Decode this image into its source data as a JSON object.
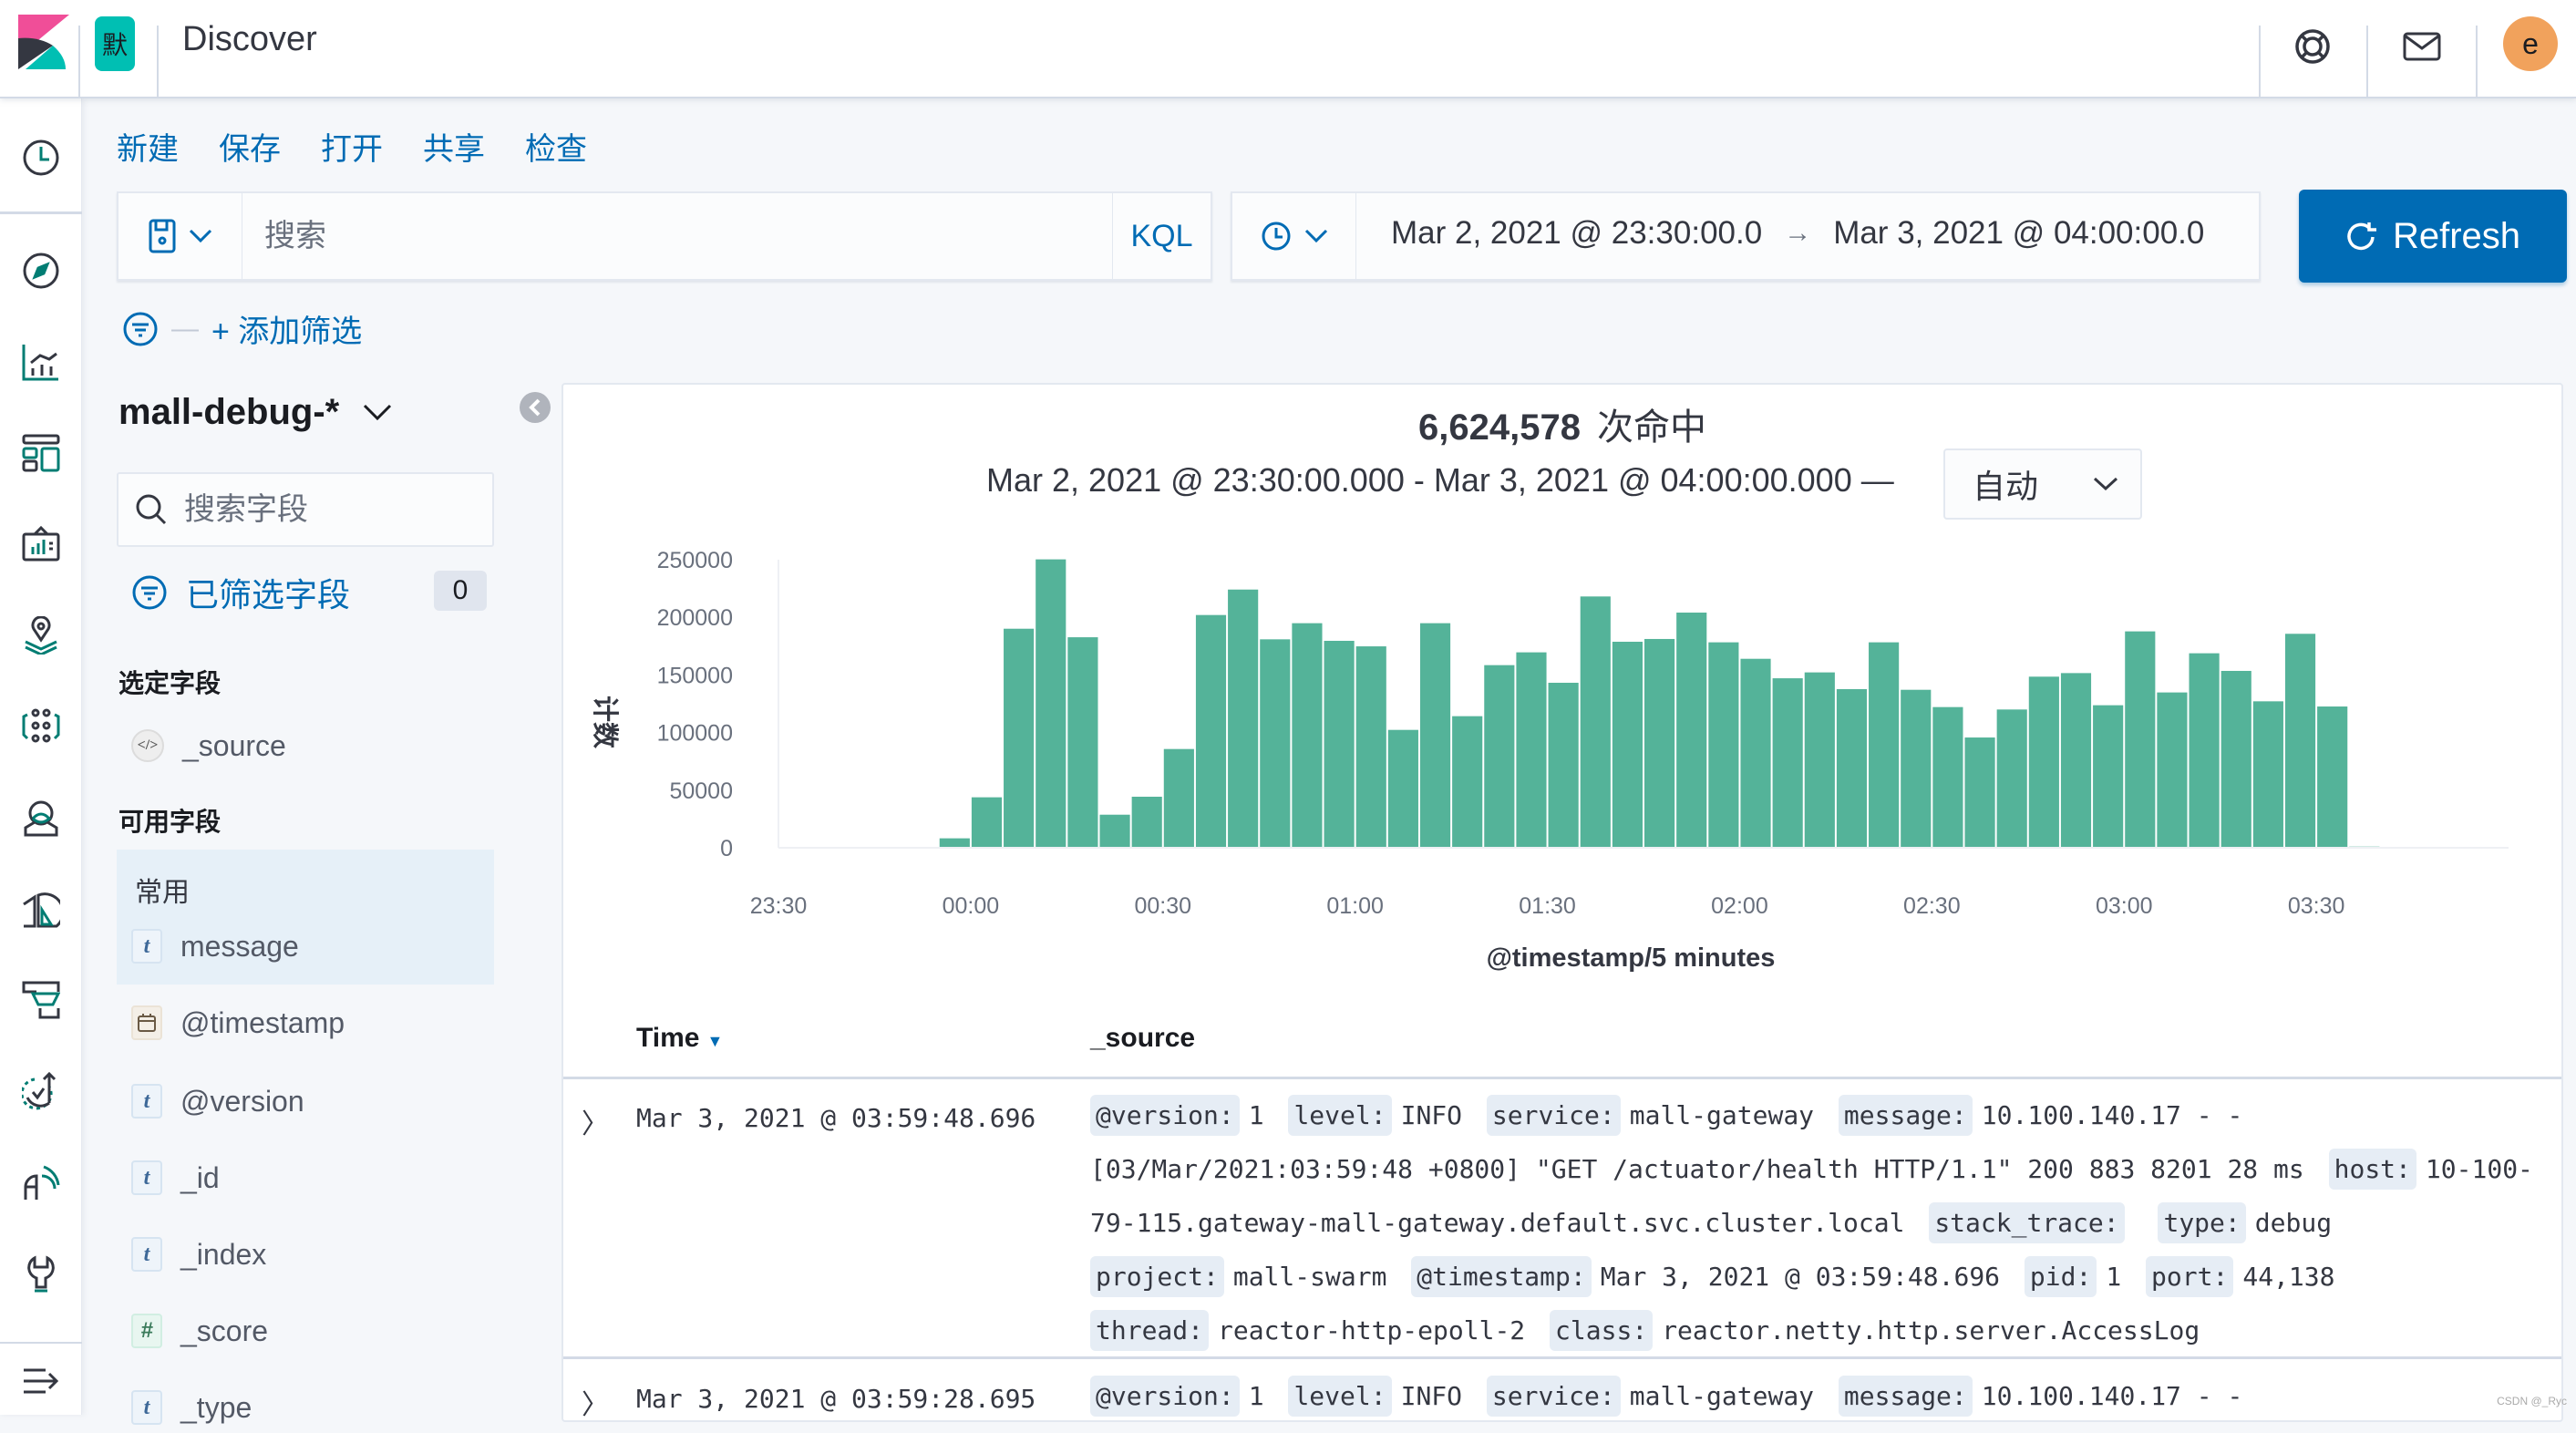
{
  "header": {
    "space_initial": "默",
    "app_title": "Discover",
    "user_initial": "e",
    "colors": {
      "space": "#00bfb3",
      "avatar": "#f1a25c",
      "accent": "#006bb4",
      "bar": "#54b399"
    }
  },
  "sidenav": {
    "items": [
      {
        "icon": "clock-icon",
        "label": "Recently viewed"
      },
      {
        "icon": "compass-icon",
        "label": "Discover"
      },
      {
        "icon": "visualize-icon",
        "label": "Visualize"
      },
      {
        "icon": "dashboard-icon",
        "label": "Dashboard"
      },
      {
        "icon": "canvas-icon",
        "label": "Canvas"
      },
      {
        "icon": "maps-icon",
        "label": "Maps"
      },
      {
        "icon": "ml-icon",
        "label": "Machine Learning"
      },
      {
        "icon": "metrics-icon",
        "label": "Metrics"
      },
      {
        "icon": "logs-icon",
        "label": "Logs"
      },
      {
        "icon": "apm-icon",
        "label": "APM"
      },
      {
        "icon": "uptime-icon",
        "label": "Uptime"
      },
      {
        "icon": "siem-icon",
        "label": "SIEM"
      },
      {
        "icon": "devtools-icon",
        "label": "Dev Tools"
      },
      {
        "icon": "dock-icon",
        "label": "Dock navigation"
      }
    ]
  },
  "menu": {
    "new": "新建",
    "save": "保存",
    "open": "打开",
    "share": "共享",
    "inspect": "检查"
  },
  "query": {
    "placeholder": "搜索",
    "value": "",
    "language": "KQL"
  },
  "time": {
    "start": "Mar 2, 2021 @ 23:30:00.0",
    "arrow": "→",
    "end": "Mar 3, 2021 @ 04:00:00.0",
    "refresh_label": "Refresh"
  },
  "filters": {
    "add_label": "+ 添加筛选"
  },
  "sidebar": {
    "index_pattern": "mall-debug-*",
    "field_search_placeholder": "搜索字段",
    "filtered_fields_label": "已筛选字段",
    "filtered_fields_count": "0",
    "selected_title": "选定字段",
    "selected_fields": [
      {
        "type": "source",
        "name": "_source"
      }
    ],
    "available_title": "可用字段",
    "popular_label": "常用",
    "popular_fields": [
      {
        "type": "t",
        "name": "message"
      }
    ],
    "available_fields": [
      {
        "type": "date",
        "name": "@timestamp"
      },
      {
        "type": "t",
        "name": "@version"
      },
      {
        "type": "t",
        "name": "_id"
      },
      {
        "type": "t",
        "name": "_index"
      },
      {
        "type": "#",
        "name": "_score"
      },
      {
        "type": "t",
        "name": "_type"
      }
    ]
  },
  "histogram": {
    "hits_count": "6,624,578",
    "hits_label": "次命中",
    "range_text": "Mar 2, 2021 @ 23:30:00.000 - Mar 3, 2021 @ 04:00:00.000 —",
    "interval_value": "自动"
  },
  "chart_data": {
    "type": "bar",
    "title": "",
    "xlabel": "@timestamp/5 minutes",
    "ylabel": "计数",
    "x_range": [
      "23:30",
      "04:00"
    ],
    "ylim": [
      0,
      250000
    ],
    "y_ticks": [
      "0",
      "50000",
      "100000",
      "150000",
      "200000",
      "250000"
    ],
    "x_ticks": [
      "23:30",
      "00:00",
      "00:30",
      "01:00",
      "01:30",
      "02:00",
      "02:30",
      "03:00",
      "03:30"
    ],
    "grid": false,
    "bar_color": "#54b399",
    "categories": [
      "23:55",
      "00:00",
      "00:05",
      "00:10",
      "00:15",
      "00:20",
      "00:25",
      "00:30",
      "00:35",
      "00:40",
      "00:45",
      "00:50",
      "00:55",
      "01:00",
      "01:05",
      "01:10",
      "01:15",
      "01:20",
      "01:25",
      "01:30",
      "01:35",
      "01:40",
      "01:45",
      "01:50",
      "01:55",
      "02:00",
      "02:05",
      "02:10",
      "02:15",
      "02:20",
      "02:25",
      "02:30",
      "02:35",
      "02:40",
      "02:45",
      "02:50",
      "02:55",
      "03:00",
      "03:05",
      "03:10",
      "03:15",
      "03:20",
      "03:25",
      "03:30",
      "03:35"
    ],
    "values": [
      8200,
      43800,
      190100,
      250300,
      182700,
      28700,
      44300,
      85700,
      202000,
      224100,
      180900,
      194900,
      179600,
      174800,
      102300,
      194900,
      114200,
      158500,
      169600,
      143200,
      218100,
      178800,
      181200,
      204100,
      178300,
      164000,
      147100,
      152200,
      137700,
      178300,
      137100,
      122100,
      95700,
      120000,
      148500,
      151600,
      123700,
      187800,
      134800,
      168800,
      153500,
      127100,
      185700,
      122600,
      1000
    ]
  },
  "table": {
    "columns": {
      "time": "Time",
      "source": "_source"
    },
    "rows": [
      {
        "time": "Mar 3, 2021 @ 03:59:48.696",
        "fields": [
          {
            "k": "@version:",
            "v": "1"
          },
          {
            "k": "level:",
            "v": "INFO"
          },
          {
            "k": "service:",
            "v": "mall-gateway"
          },
          {
            "k": "message:",
            "v": "10.100.140.17 - - [03/Mar/2021:03:59:48 +0800] \"GET /actuator/health HTTP/1.1\" 200 883 8201 28 ms"
          },
          {
            "k": "host:",
            "v": "10-100-79-115.gateway-mall-gateway.default.svc.cluster.local"
          },
          {
            "k": "stack_trace:",
            "v": ""
          },
          {
            "k": "type:",
            "v": "debug"
          },
          {
            "k": "project:",
            "v": "mall-swarm"
          },
          {
            "k": "@timestamp:",
            "v": "Mar 3, 2021 @ 03:59:48.696"
          },
          {
            "k": "pid:",
            "v": "1"
          },
          {
            "k": "port:",
            "v": "44,138"
          },
          {
            "k": "thread:",
            "v": "reactor-http-epoll-2"
          },
          {
            "k": "class:",
            "v": "reactor.netty.http.server.AccessLog"
          }
        ]
      },
      {
        "time": "Mar 3, 2021 @ 03:59:28.695",
        "fields": [
          {
            "k": "@version:",
            "v": "1"
          },
          {
            "k": "level:",
            "v": "INFO"
          },
          {
            "k": "service:",
            "v": "mall-gateway"
          },
          {
            "k": "message:",
            "v": "10.100.140.17 - -"
          }
        ]
      }
    ]
  },
  "watermark": "CSDN @_Ryc"
}
